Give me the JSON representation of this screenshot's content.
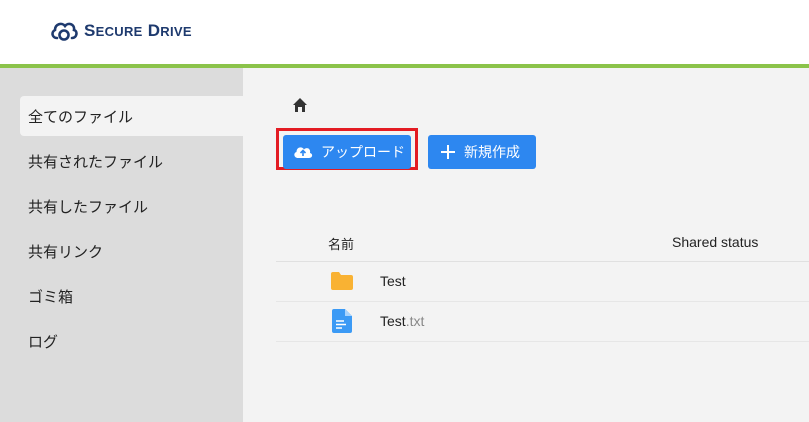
{
  "brand": {
    "name_first_initial": "S",
    "name_first_rest": "ECURE",
    "name_second_initial": "D",
    "name_second_rest": "RIVE",
    "color": "#1e3a6e",
    "accent": "#8bc34a"
  },
  "sidebar": {
    "items": [
      {
        "label": "全てのファイル",
        "active": true
      },
      {
        "label": "共有されたファイル"
      },
      {
        "label": "共有したファイル"
      },
      {
        "label": "共有リンク"
      },
      {
        "label": "ゴミ箱"
      },
      {
        "label": "ログ"
      }
    ]
  },
  "breadcrumb": {
    "icon": "home-icon"
  },
  "toolbar": {
    "upload_label": "アップロード",
    "new_label": "新規作成",
    "button_color": "#2d87f0",
    "highlight_color": "#e31b23"
  },
  "table": {
    "headers": {
      "name": "名前",
      "shared": "Shared status"
    },
    "rows": [
      {
        "name": "Test",
        "ext": "",
        "icon": "folder-icon"
      },
      {
        "name": "Test",
        "ext": ".txt",
        "icon": "file-text-icon"
      }
    ]
  }
}
